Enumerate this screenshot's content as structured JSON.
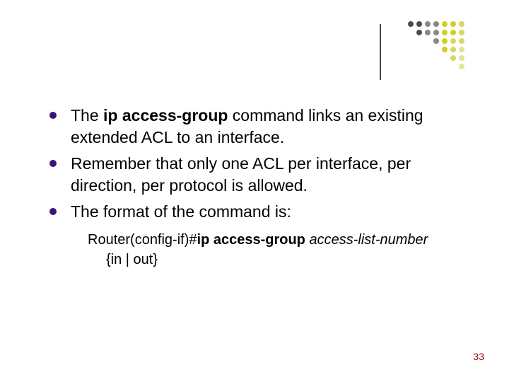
{
  "decoration": {
    "line_color": "#4c4c4c",
    "dot_colors": [
      "#4c4c4c",
      "#888888",
      "#cfcf24",
      "#d8d85f",
      "#e4e498"
    ]
  },
  "bullets": [
    {
      "pre": "The ",
      "bold": "ip access-group",
      "post": " command links an existing extended ACL to an interface."
    },
    {
      "pre": "",
      "bold": "",
      "post": "Remember that only one ACL per interface, per direction, per protocol is allowed."
    },
    {
      "pre": "",
      "bold": "",
      "post": "The format of the command is:"
    }
  ],
  "code": {
    "prefix": "Router(config-if)#",
    "bold": "ip access-group",
    "italic": " access-list-number",
    "line2": "{in | out}"
  },
  "page_number": "33"
}
